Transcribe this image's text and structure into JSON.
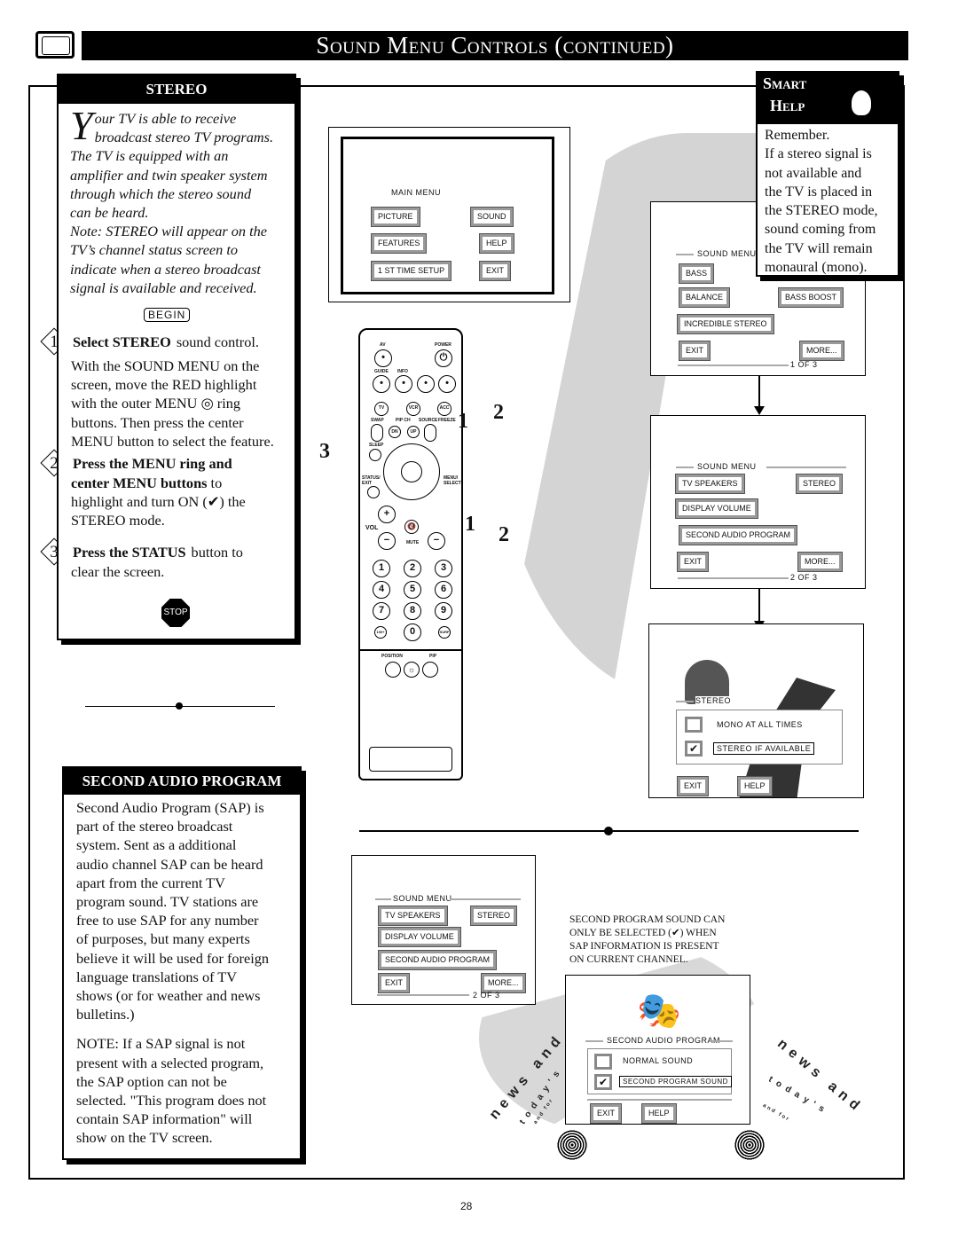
{
  "header": {
    "title": "Sound Menu Controls (continued)"
  },
  "stereo": {
    "title": "STEREO",
    "intro_drop": "Y",
    "intro": [
      "our TV is able to receive",
      "broadcast stereo TV programs.",
      "The TV is equipped with an",
      "amplifier and twin speaker system",
      "through which the stereo sound",
      "can be heard.",
      "Note: STEREO will appear on the",
      "TV’s channel status screen to",
      "indicate when a stereo broadcast",
      "signal is available and received."
    ],
    "begin": "BEGIN",
    "steps": [
      {
        "num": "1",
        "bold": "Select STEREO",
        "rest": " sound control.",
        "lines": [
          "With the SOUND MENU on the",
          "screen, move the RED highlight",
          "with the outer MENU ◎ ring",
          "buttons. Then press the center",
          "MENU button to select the feature."
        ]
      },
      {
        "num": "2",
        "bold": "Press the MENU ring and",
        "bold2": "center MENU buttons",
        "rest": " to",
        "lines": [
          "highlight and turn ON (✔) the",
          "STEREO mode."
        ]
      },
      {
        "num": "3",
        "bold": "Press the STATUS",
        "rest": " button to",
        "lines": [
          "clear the screen."
        ]
      }
    ],
    "stop": "STOP"
  },
  "smart_help": {
    "title1": "Smart",
    "title2": "Help",
    "lines": [
      "Remember.",
      "If a stereo signal is",
      "not available and",
      "the TV is placed in",
      "the STEREO mode,",
      "sound coming from",
      "the TV will remain",
      "monaural (mono)."
    ]
  },
  "main_menu": {
    "title": "MAIN MENU",
    "buttons": [
      "PICTURE",
      "SOUND",
      "FEATURES",
      "HELP",
      "1 ST TIME SETUP",
      "EXIT"
    ]
  },
  "remote": {
    "labels": [
      "AV",
      "POWER",
      "GUIDE",
      "INFO",
      "TV",
      "VCR",
      "ACC",
      "SWAP",
      "PIP CH",
      "SOURCE",
      "FREEZE",
      "DN",
      "UP",
      "SLEEP",
      "STATUS/ EXIT",
      "MENU/ SELECT",
      "VOL",
      "MUTE",
      "POSITION",
      "PIP"
    ],
    "digits": [
      "1",
      "2",
      "3",
      "4",
      "5",
      "6",
      "7",
      "8",
      "9",
      "100+",
      "0",
      "SURF"
    ]
  },
  "callouts": [
    "3",
    "1",
    "2",
    "1",
    "2"
  ],
  "sound_menu_1": {
    "title": "SOUND MENU",
    "buttons": [
      "BASS",
      "BALANCE",
      "BASS BOOST",
      "INCREDIBLE STEREO",
      "EXIT",
      "MORE..."
    ],
    "page": "1 OF 3"
  },
  "sound_menu_2": {
    "title": "SOUND MENU",
    "buttons": [
      "TV SPEAKERS",
      "STEREO",
      "DISPLAY VOLUME",
      "SECOND AUDIO PROGRAM",
      "EXIT",
      "MORE..."
    ],
    "page": "2 OF 3"
  },
  "stereo_screen": {
    "title": "STEREO",
    "options": [
      {
        "label": "MONO AT ALL TIMES",
        "checked": false
      },
      {
        "label": "STEREO IF AVAILABLE",
        "checked": true
      }
    ],
    "buttons": [
      "EXIT",
      "HELP"
    ]
  },
  "sap": {
    "title": "SECOND AUDIO PROGRAM",
    "para1": [
      "Second Audio Program (SAP) is",
      "part of the stereo broadcast",
      "system.  Sent as a additional",
      "audio channel SAP can be heard",
      "apart from the current TV",
      "program sound. TV stations are",
      "free to use SAP for any number",
      "of purposes, but many experts",
      "believe it will be used for foreign",
      "language translations of TV",
      "shows (or for weather and news",
      "bulletins.)"
    ],
    "para2": [
      "NOTE: If a SAP signal is not",
      "present with a selected program,",
      "the SAP option can not be",
      "selected.  \"This program does not",
      "contain SAP information\" will",
      "show on the TV screen."
    ]
  },
  "sap_menu": {
    "title": "SOUND MENU",
    "buttons": [
      "TV SPEAKERS",
      "STEREO",
      "DISPLAY VOLUME",
      "SECOND AUDIO PROGRAM",
      "EXIT",
      "MORE..."
    ],
    "page": "2 OF 3"
  },
  "sap_note": [
    "SECOND PROGRAM SOUND CAN",
    "ONLY BE SELECTED (✔) WHEN",
    "SAP INFORMATION IS PRESENT",
    "ON CURRENT CHANNEL."
  ],
  "sap_screen": {
    "title": "SECOND AUDIO PROGRAM",
    "options": [
      {
        "label": "NORMAL SOUND",
        "checked": false
      },
      {
        "label": "SECOND PROGRAM SOUND",
        "checked": true
      }
    ],
    "buttons": [
      "EXIT",
      "HELP"
    ]
  },
  "news_logo": {
    "text1": "news and",
    "text2": "today's",
    "text3": "and for"
  },
  "page_number": "28"
}
